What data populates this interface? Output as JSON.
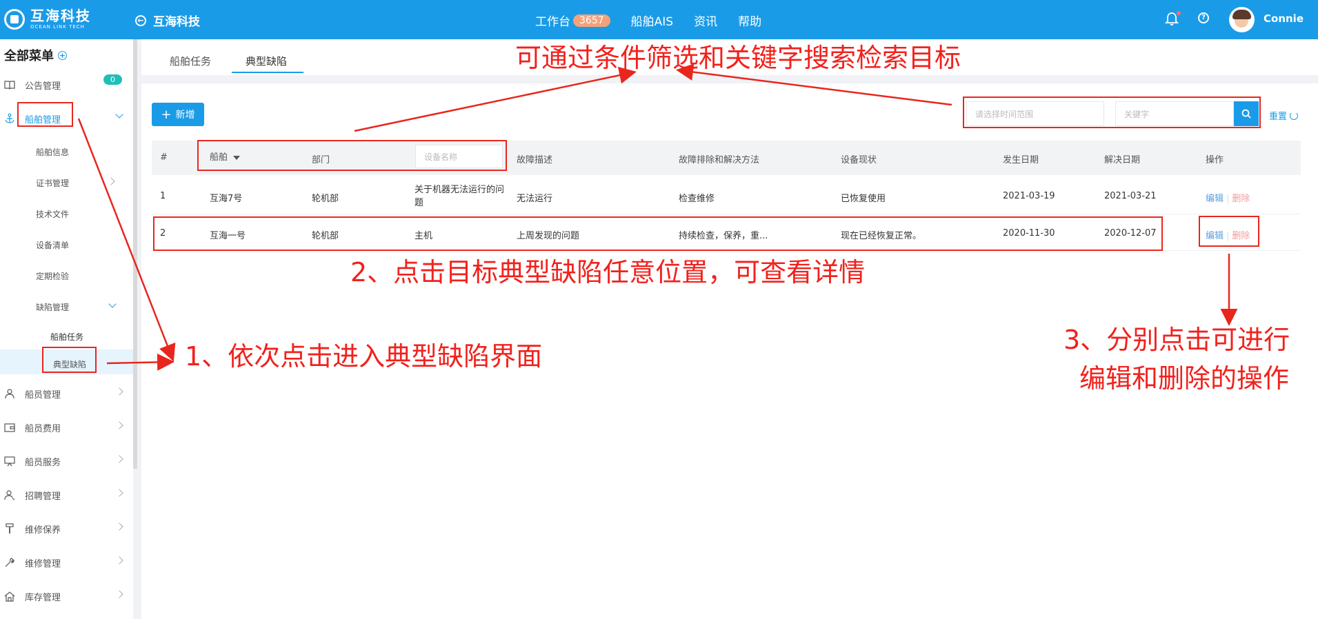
{
  "header": {
    "logo_cn": "互海科技",
    "logo_en": "OCEAN LINK TECH",
    "back_label": "互海科技",
    "nav": [
      {
        "label": "工作台",
        "badge": "3657"
      },
      {
        "label": "船舶AIS"
      },
      {
        "label": "资讯"
      },
      {
        "label": "帮助"
      }
    ],
    "username": "Connie",
    "help_glyph": "?"
  },
  "sidebar": {
    "title": "全部菜单",
    "items": [
      {
        "label": "公告管理",
        "icon": "book-icon",
        "badge": "0"
      },
      {
        "label": "船舶管理",
        "icon": "anchor-icon"
      },
      {
        "label": "船员管理",
        "icon": "person-icon"
      },
      {
        "label": "船员费用",
        "icon": "wallet-icon"
      },
      {
        "label": "船员服务",
        "icon": "monitor-icon"
      },
      {
        "label": "招聘管理",
        "icon": "person-search-icon"
      },
      {
        "label": "维修保养",
        "icon": "hammer-icon"
      },
      {
        "label": "维修管理",
        "icon": "wrench-icon"
      },
      {
        "label": "库存管理",
        "icon": "home-icon"
      }
    ],
    "ship_sub": [
      "船舶信息",
      "证书管理",
      "技术文件",
      "设备清单",
      "定期检验",
      "缺陷管理"
    ],
    "defect_sub": [
      "船舶任务",
      "典型缺陷"
    ]
  },
  "tabs": [
    "船舶任务",
    "典型缺陷"
  ],
  "toolbar": {
    "add_label": "新增",
    "date_placeholder": "请选择时间范围",
    "keyword_placeholder": "关键字",
    "reset_label": "重置"
  },
  "table": {
    "headers": {
      "index": "#",
      "ship": "船舶",
      "dept": "部门",
      "device_placeholder": "设备名称",
      "fault": "故障描述",
      "solution": "故障排除和解决方法",
      "status": "设备现状",
      "occur": "发生日期",
      "resolve": "解决日期",
      "ops": "操作"
    },
    "rows": [
      {
        "index": "1",
        "ship": "互海7号",
        "dept": "轮机部",
        "device": "关于机器无法运行的问题",
        "fault": "无法运行",
        "solution": "检查维修",
        "status": "已恢复使用",
        "occur": "2021-03-19",
        "resolve": "2021-03-21",
        "edit": "编辑",
        "delete": "删除"
      },
      {
        "index": "2",
        "ship": "互海一号",
        "dept": "轮机部",
        "device": "主机",
        "fault": "上周发现的问题",
        "solution": "持续检查，保养，重...",
        "status": "现在已经恢复正常。",
        "occur": "2020-11-30",
        "resolve": "2020-12-07",
        "edit": "编辑",
        "delete": "删除"
      }
    ]
  },
  "annotations": {
    "top": "可通过条件筛选和关键字搜索检索目标",
    "step1": "1、依次点击进入典型缺陷界面",
    "step2": "2、点击目标典型缺陷任意位置，可查看详情",
    "step3_line1": "3、分别点击可进行",
    "step3_line2": "编辑和删除的操作"
  },
  "colors": {
    "primary": "#1a9be8",
    "annotation": "#f2211c",
    "badge_teal": "#1fbfb8",
    "badge_orange": "#f5a27a"
  }
}
